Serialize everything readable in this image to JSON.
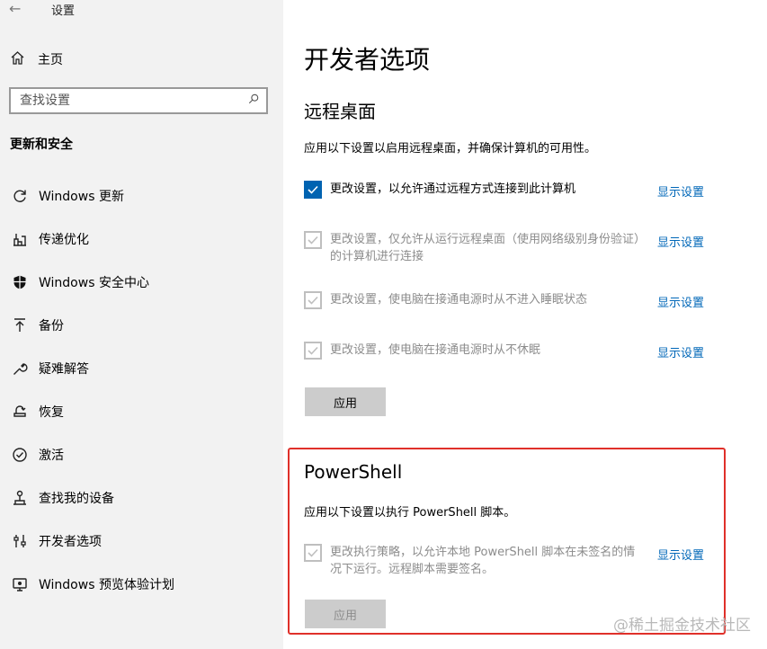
{
  "window": {
    "title": "设置"
  },
  "sidebar": {
    "home_label": "主页",
    "search_placeholder": "查找设置",
    "section_title": "更新和安全",
    "items": [
      {
        "label": "Windows 更新",
        "icon": "refresh-icon"
      },
      {
        "label": "传递优化",
        "icon": "delivery-optimization-icon"
      },
      {
        "label": "Windows 安全中心",
        "icon": "shield-icon"
      },
      {
        "label": "备份",
        "icon": "backup-arrow-icon"
      },
      {
        "label": "疑难解答",
        "icon": "wrench-icon"
      },
      {
        "label": "恢复",
        "icon": "recovery-icon"
      },
      {
        "label": "激活",
        "icon": "check-circle-icon"
      },
      {
        "label": "查找我的设备",
        "icon": "find-device-icon"
      },
      {
        "label": "开发者选项",
        "icon": "developer-sliders-icon"
      },
      {
        "label": "Windows 预览体验计划",
        "icon": "insider-icon"
      }
    ]
  },
  "main": {
    "page_title": "开发者选项",
    "remote_desktop": {
      "title": "远程桌面",
      "description": "应用以下设置以启用远程桌面，并确保计算机的可用性。",
      "options": [
        {
          "text": "更改设置，以允许通过远程方式连接到此计算机",
          "link": "显示设置",
          "checked": true,
          "enabled": true
        },
        {
          "text": "更改设置，仅允许从运行远程桌面（使用网络级别身份验证）的计算机进行连接",
          "link": "显示设置",
          "checked": true,
          "enabled": false
        },
        {
          "text": "更改设置，使电脑在接通电源时从不进入睡眠状态",
          "link": "显示设置",
          "checked": true,
          "enabled": false
        },
        {
          "text": "更改设置，使电脑在接通电源时从不休眠",
          "link": "显示设置",
          "checked": true,
          "enabled": false
        }
      ],
      "apply_label": "应用"
    },
    "powershell": {
      "title": "PowerShell",
      "description": "应用以下设置以执行 PowerShell 脚本。",
      "option": {
        "text": "更改执行策略，以允许本地 PowerShell 脚本在未签名的情况下运行。远程脚本需要签名。",
        "link": "显示设置",
        "checked": true,
        "enabled": false
      },
      "apply_label": "应用"
    }
  },
  "watermark": "@稀土掘金技术社区",
  "colors": {
    "accent": "#0063b1",
    "link": "#0067b8",
    "highlight": "#e0302a",
    "sidebar_bg": "#f2f2f2"
  }
}
